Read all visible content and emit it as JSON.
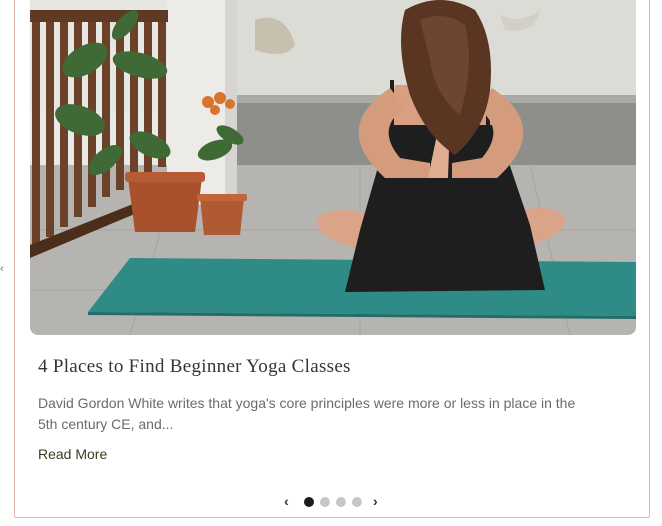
{
  "slider": {
    "prev_edge_glyph": "‹",
    "prev_glyph": "‹",
    "next_glyph": "›",
    "dots": [
      {
        "active": true
      },
      {
        "active": false
      },
      {
        "active": false
      },
      {
        "active": false
      }
    ],
    "active_index": 0
  },
  "post": {
    "image_icon": "yoga-photo",
    "title": "4 Places to Find Beginner Yoga Classes",
    "excerpt": "David Gordon White writes that yoga's core principles were more or less in place in the 5th century CE, and...",
    "read_more": "Read More"
  },
  "colors": {
    "frame_border": "#e3b7a3",
    "mat": "#2e8b86",
    "title": "#2f3a2f",
    "dot_active": "#1b1b1b",
    "dot_inactive": "#c7c7c7"
  }
}
